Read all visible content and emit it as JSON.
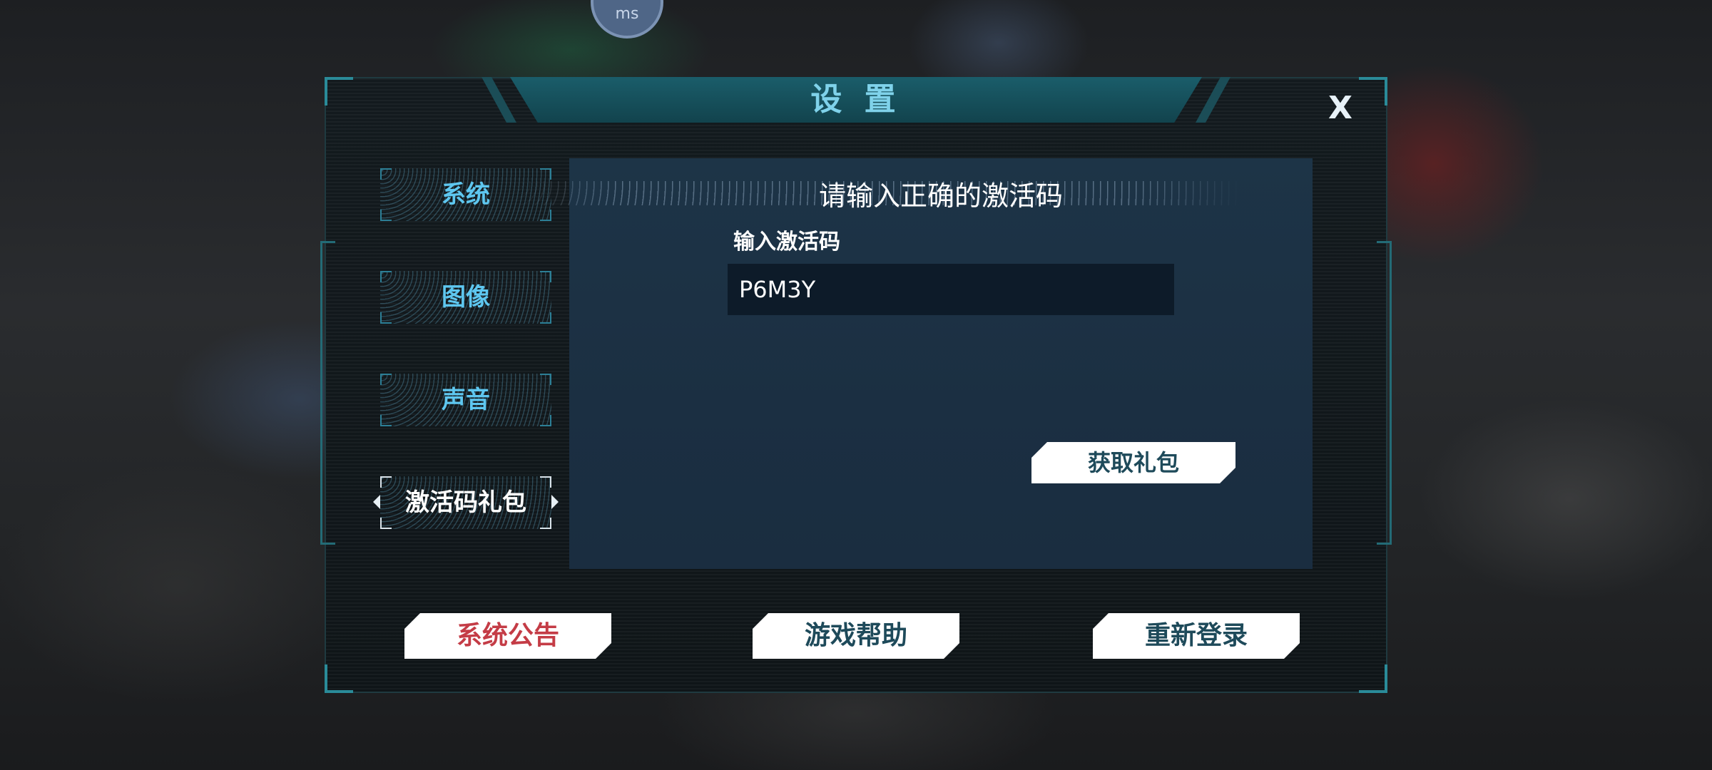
{
  "status": {
    "ping_unit": "ms"
  },
  "dialog": {
    "title": "设 置",
    "close_label": "X"
  },
  "tabs": [
    {
      "label": "系统"
    },
    {
      "label": "图像"
    },
    {
      "label": "声音"
    },
    {
      "label": "激活码礼包",
      "active": true
    }
  ],
  "content": {
    "hint": "请输入正确的激活码",
    "input_label": "输入激活码",
    "input_value": "P6M3Y",
    "gift_button": "获取礼包"
  },
  "footer": {
    "announcement": "系统公告",
    "help": "游戏帮助",
    "relogin": "重新登录"
  },
  "colors": {
    "accent": "#2a8b99",
    "tab_text": "#5ec7f0",
    "announcement_text": "#c43c46",
    "button_text": "#1e4a5a"
  }
}
